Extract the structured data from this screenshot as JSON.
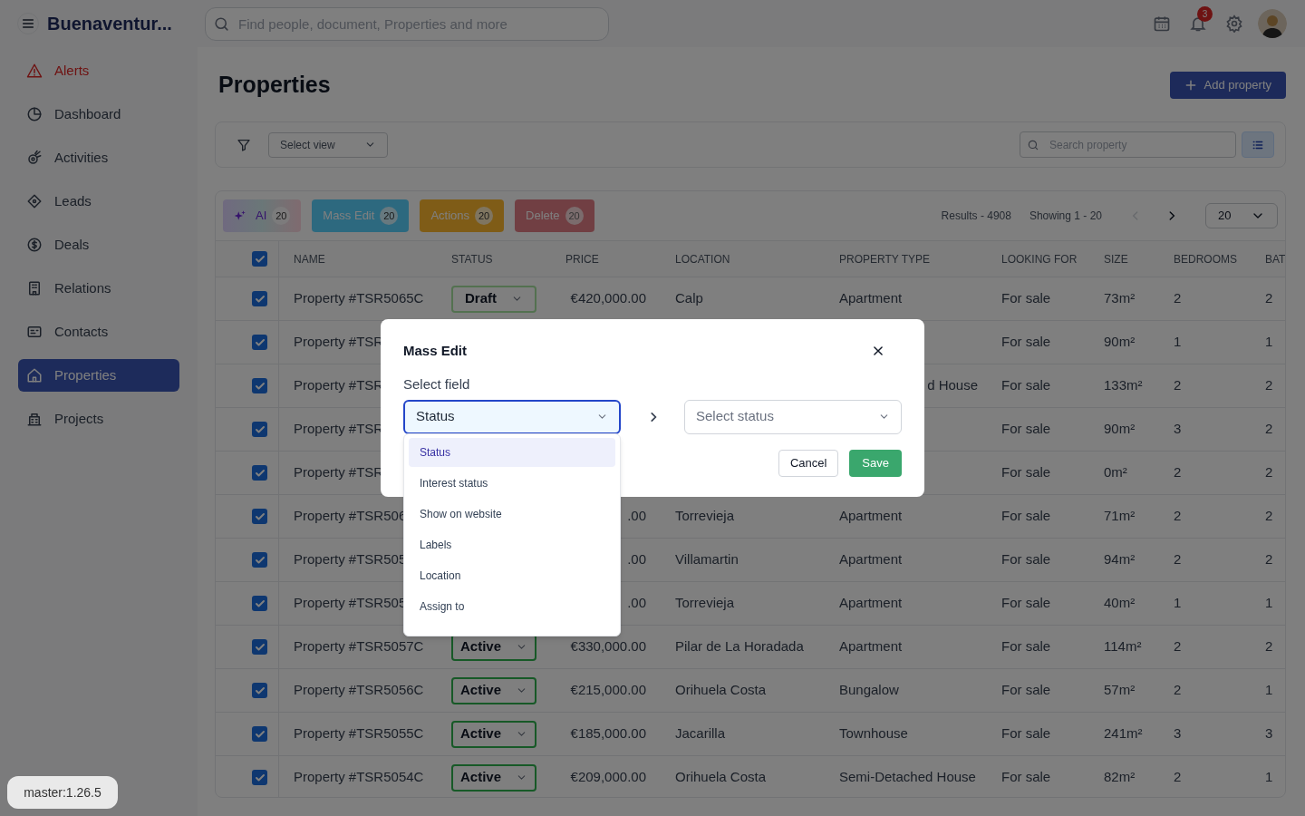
{
  "topbar": {
    "brand": "Buenaventur...",
    "search": {
      "placeholder": "Find people, document, Properties and more"
    },
    "notifications": "3"
  },
  "sidebar": {
    "items": [
      {
        "label": "Alerts",
        "kind": "alert",
        "selected": false
      },
      {
        "label": "Dashboard",
        "kind": "normal",
        "selected": false
      },
      {
        "label": "Activities",
        "kind": "normal",
        "selected": false
      },
      {
        "label": "Leads",
        "kind": "normal",
        "selected": false
      },
      {
        "label": "Deals",
        "kind": "normal",
        "selected": false
      },
      {
        "label": "Relations",
        "kind": "normal",
        "selected": false
      },
      {
        "label": "Contacts",
        "kind": "normal",
        "selected": false
      },
      {
        "label": "Properties",
        "kind": "normal",
        "selected": true
      },
      {
        "label": "Projects",
        "kind": "normal",
        "selected": false
      }
    ]
  },
  "page": {
    "title": "Properties",
    "add_button": "Add property"
  },
  "filter_bar": {
    "view_select": "Select view",
    "search": {
      "placeholder": "Search property"
    }
  },
  "bulk_actions": [
    {
      "label": "AI",
      "count": "20",
      "kind": "ai",
      "disabled": false
    },
    {
      "label": "Mass Edit",
      "count": "20",
      "kind": "mass_edit",
      "disabled": false
    },
    {
      "label": "Actions",
      "count": "20",
      "kind": "actions",
      "disabled": false
    },
    {
      "label": "Delete",
      "count": "20",
      "kind": "delete",
      "disabled": true
    }
  ],
  "pagination": {
    "results": "Results - 4908",
    "showing": "Showing 1 - 20",
    "prev_disabled": true,
    "next_disabled": false,
    "page_size": "20"
  },
  "table": {
    "columns": [
      "NAME",
      "STATUS",
      "PRICE",
      "LOCATION",
      "PROPERTY TYPE",
      "LOOKING FOR",
      "SIZE",
      "BEDROOMS",
      "BAT"
    ],
    "all_checked": true,
    "rows": [
      {
        "checked": true,
        "name": "Property #TSR5065C",
        "status": {
          "label": "Draft",
          "kind": "draft"
        },
        "price": "€420,000.00",
        "location": "Calp",
        "property_type": "Apartment",
        "looking_for": "For sale",
        "size": "73m²",
        "bedrooms": "2",
        "bathrooms": "2"
      },
      {
        "checked": true,
        "name": "Property #TSR",
        "looking_for": "For sale",
        "size": "90m²",
        "bedrooms": "1",
        "bathrooms": "1"
      },
      {
        "checked": true,
        "name": "Property #TSR",
        "property_type_tail": "d House",
        "looking_for": "For sale",
        "size": "133m²",
        "bedrooms": "2",
        "bathrooms": "2"
      },
      {
        "checked": true,
        "name": "Property #TSR",
        "looking_for": "For sale",
        "size": "90m²",
        "bedrooms": "3",
        "bathrooms": "2"
      },
      {
        "checked": true,
        "name": "Property #TSR",
        "looking_for": "For sale",
        "size": "0m²",
        "bedrooms": "2",
        "bathrooms": "2"
      },
      {
        "checked": true,
        "name": "Property #TSR506",
        "price": ".00",
        "location": "Torrevieja",
        "property_type": "Apartment",
        "looking_for": "For sale",
        "size": "71m²",
        "bedrooms": "2",
        "bathrooms": "2"
      },
      {
        "checked": true,
        "name": "Property #TSR505",
        "price": ".00",
        "location": "Villamartin",
        "property_type": "Apartment",
        "looking_for": "For sale",
        "size": "94m²",
        "bedrooms": "2",
        "bathrooms": "2"
      },
      {
        "checked": true,
        "name": "Property #TSR505",
        "price": ".00",
        "location": "Torrevieja",
        "property_type": "Apartment",
        "looking_for": "For sale",
        "size": "40m²",
        "bedrooms": "1",
        "bathrooms": "1"
      },
      {
        "checked": true,
        "name": "Property #TSR5057C",
        "status": {
          "label": "Active",
          "kind": "active"
        },
        "price": "€330,000.00",
        "location": "Pilar de La Horadada",
        "property_type": "Apartment",
        "looking_for": "For sale",
        "size": "114m²",
        "bedrooms": "2",
        "bathrooms": "2"
      },
      {
        "checked": true,
        "name": "Property #TSR5056C",
        "status": {
          "label": "Active",
          "kind": "active"
        },
        "price": "€215,000.00",
        "location": "Orihuela Costa",
        "property_type": "Bungalow",
        "looking_for": "For sale",
        "size": "57m²",
        "bedrooms": "2",
        "bathrooms": "1"
      },
      {
        "checked": true,
        "name": "Property #TSR5055C",
        "status": {
          "label": "Active",
          "kind": "active"
        },
        "price": "€185,000.00",
        "location": "Jacarilla",
        "property_type": "Townhouse",
        "looking_for": "For sale",
        "size": "241m²",
        "bedrooms": "3",
        "bathrooms": "3"
      },
      {
        "checked": true,
        "name": "Property #TSR5054C",
        "status": {
          "label": "Active",
          "kind": "active"
        },
        "price": "€209,000.00",
        "location": "Orihuela Costa",
        "property_type": "Semi-Detached House",
        "looking_for": "For sale",
        "size": "82m²",
        "bedrooms": "2",
        "bathrooms": "1"
      }
    ]
  },
  "modal": {
    "title": "Mass Edit",
    "field_label": "Select field",
    "field_select": {
      "value": "Status",
      "open": true
    },
    "value_select": {
      "placeholder": "Select status"
    },
    "options": [
      {
        "label": "Status",
        "selected": true
      },
      {
        "label": "Interest status",
        "selected": false
      },
      {
        "label": "Show on website",
        "selected": false
      },
      {
        "label": "Labels",
        "selected": false
      },
      {
        "label": "Location",
        "selected": false
      },
      {
        "label": "Assign to",
        "selected": false
      }
    ],
    "cancel": "Cancel",
    "save": "Save"
  },
  "version": "master:1.26.5"
}
